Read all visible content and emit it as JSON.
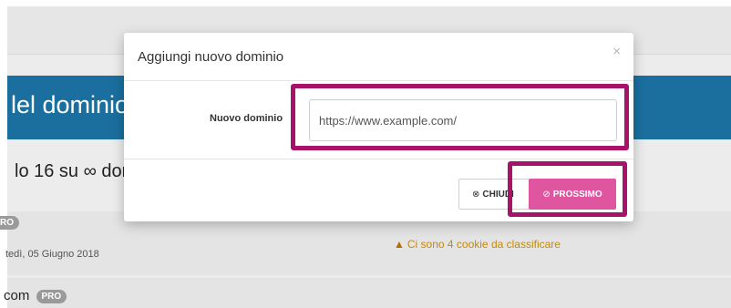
{
  "background": {
    "banner_title": "lel dominio",
    "domain_count": "lo 16 su ∞ dom",
    "row1": {
      "badge": "RO",
      "date": "tedì, 05 Giugno 2018",
      "warning_icon": "warning-triangle-icon",
      "warning_text": "Ci sono 4 cookie da classificare"
    },
    "row2": {
      "domain": "com",
      "badge": "PRO"
    }
  },
  "modal": {
    "title": "Aggiungi nuovo dominio",
    "close_glyph": "×",
    "field_label": "Nuovo dominio",
    "input_placeholder": "https://www.example.com/",
    "input_value": "",
    "close_button": {
      "icon": "circle-x-icon",
      "glyph": "⊗",
      "label": "CHIUDI"
    },
    "next_button": {
      "icon": "circle-check-icon",
      "glyph": "⊘",
      "label": "PROSSIMO"
    }
  },
  "colors": {
    "banner": "#1a6f9f",
    "next_button": "#e0559f",
    "highlight": "#a7126b",
    "warning": "#c08a10"
  }
}
